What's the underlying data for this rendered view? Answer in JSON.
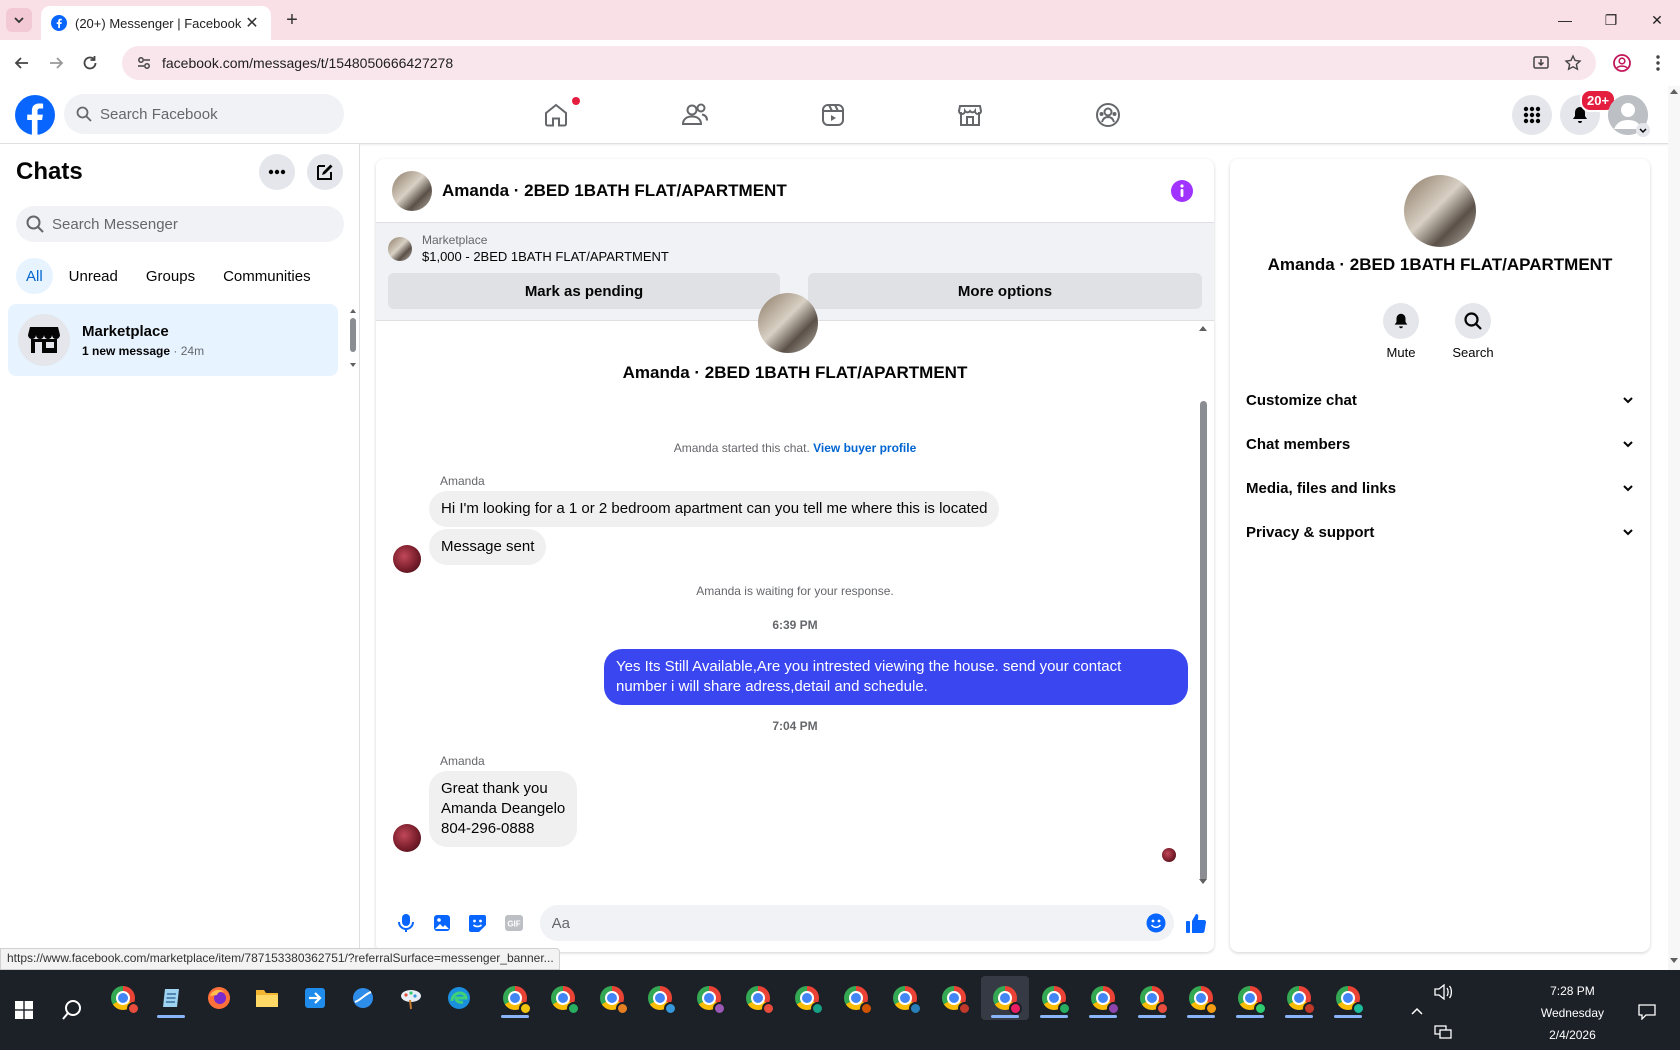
{
  "browser": {
    "tab_title": "(20+) Messenger | Facebook",
    "url": "facebook.com/messages/t/1548050666427278",
    "status_url": "https://www.facebook.com/marketplace/item/787153380362751/?referralSurface=messenger_banner..."
  },
  "fb_header": {
    "search_placeholder": "Search Facebook",
    "notification_badge": "20+"
  },
  "chats": {
    "title": "Chats",
    "search_placeholder": "Search Messenger",
    "filters": [
      "All",
      "Unread",
      "Groups",
      "Communities"
    ],
    "active_filter": "All",
    "items": [
      {
        "name": "Marketplace",
        "preview": "1 new message",
        "time": "· 24m"
      }
    ]
  },
  "conversation": {
    "title": "Amanda · 2BED 1BATH FLAT/APARTMENT",
    "marketplace_label": "Marketplace",
    "listing": "$1,000 - 2BED 1BATH FLAT/APARTMENT",
    "mark_pending_label": "Mark as pending",
    "more_options_label": "More options",
    "profile_name": "Amanda · 2BED 1BATH FLAT/APARTMENT",
    "started_text": "Amanda started this chat.",
    "view_profile_label": "View buyer profile",
    "sender_1": "Amanda",
    "msg_1": "Hi I'm looking for a 1 or 2 bedroom apartment can you tell me where this is located",
    "msg_2": "Message sent",
    "waiting_text": "Amanda is waiting for your response.",
    "time_1": "6:39 PM",
    "msg_3": "Yes Its Still Available,Are you intrested viewing the house. send your contact number i will share adress,detail and schedule.",
    "time_2": "7:04 PM",
    "sender_2": "Amanda",
    "msg_4_line1": "Great thank you",
    "msg_4_line2": "Amanda Deangelo",
    "msg_4_line3": "804-296-0888",
    "composer_placeholder": "Aa"
  },
  "info_panel": {
    "name": "Amanda · 2BED 1BATH FLAT/APARTMENT",
    "mute_label": "Mute",
    "search_label": "Search",
    "sections": [
      "Customize chat",
      "Chat members",
      "Media, files and links",
      "Privacy & support"
    ]
  },
  "taskbar": {
    "time": "7:28 PM",
    "day": "Wednesday",
    "date": "2/4/2026"
  },
  "colors": {
    "fb_blue": "#0866ff",
    "accent_purple": "#a033ff",
    "outgoing_bubble": "#3a47f0",
    "tab_strip": "#f9dfe6"
  }
}
